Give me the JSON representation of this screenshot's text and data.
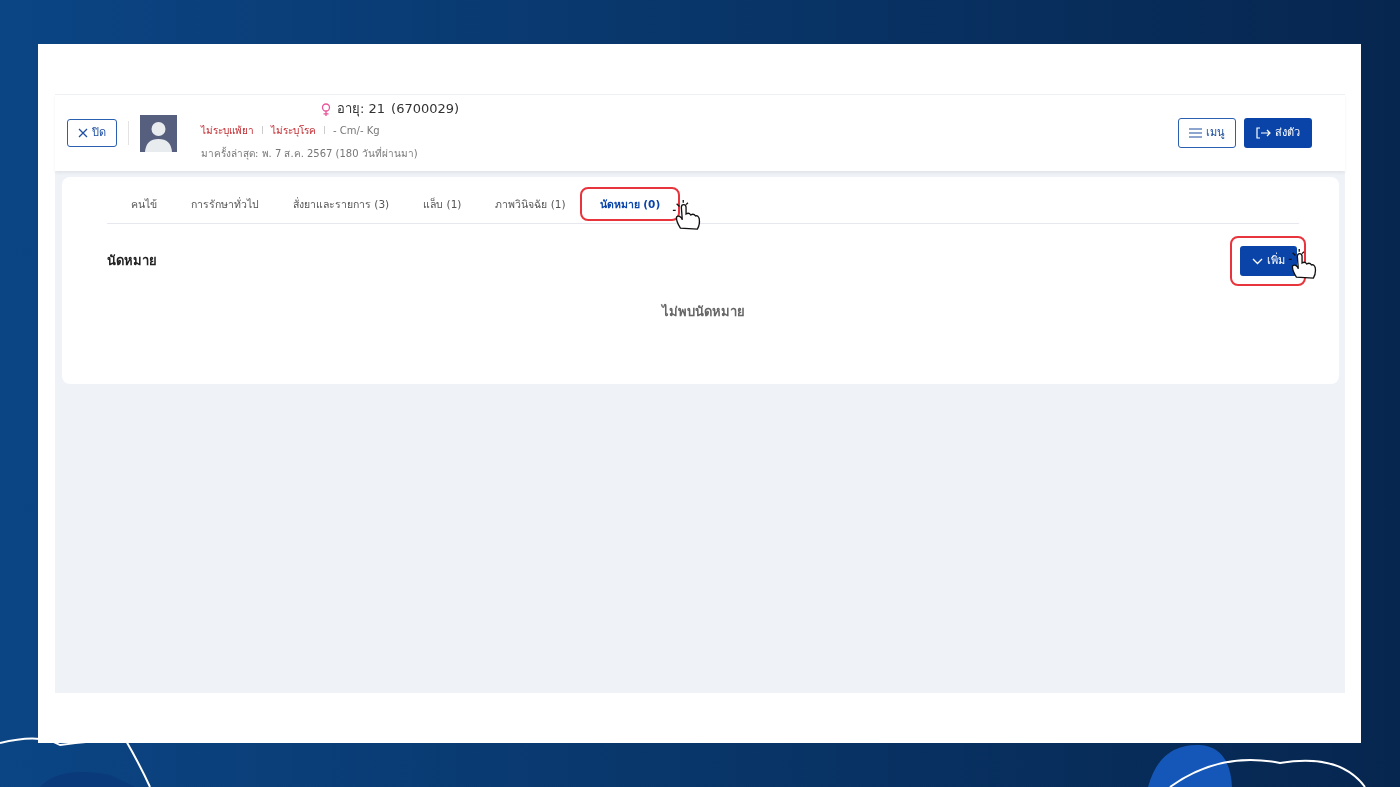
{
  "header": {
    "close_button": "ปิด",
    "age": "อายุ: 21",
    "patient_id": "(6700029)",
    "allergy": "ไม่ระบุแพ้ยา",
    "disease": "ไม่ระบุโรค",
    "body_size": "- Cm/- Kg",
    "last_visit": "มาครั้งล่าสุด: พ. 7 ส.ค. 2567 (180 วันที่ผ่านมา)",
    "menu_button": "เมนู",
    "send_button": "ส่งตัว"
  },
  "tabs": [
    {
      "label": "คนไข้",
      "selected": false,
      "highlighted": false
    },
    {
      "label": "การรักษาทั่วไป",
      "selected": false,
      "highlighted": false
    },
    {
      "label": "สั่งยาและรายการ (3)",
      "selected": false,
      "highlighted": false
    },
    {
      "label": "แล็บ (1)",
      "selected": false,
      "highlighted": false
    },
    {
      "label": "ภาพวินิจฉัย (1)",
      "selected": false,
      "highlighted": false
    },
    {
      "label": "นัดหมาย (0)",
      "selected": true,
      "highlighted": true
    }
  ],
  "section": {
    "title": "นัดหมาย",
    "add_button": "เพิ่ม",
    "add_highlighted": true,
    "empty_message": "ไม่พบนัดหมาย"
  }
}
